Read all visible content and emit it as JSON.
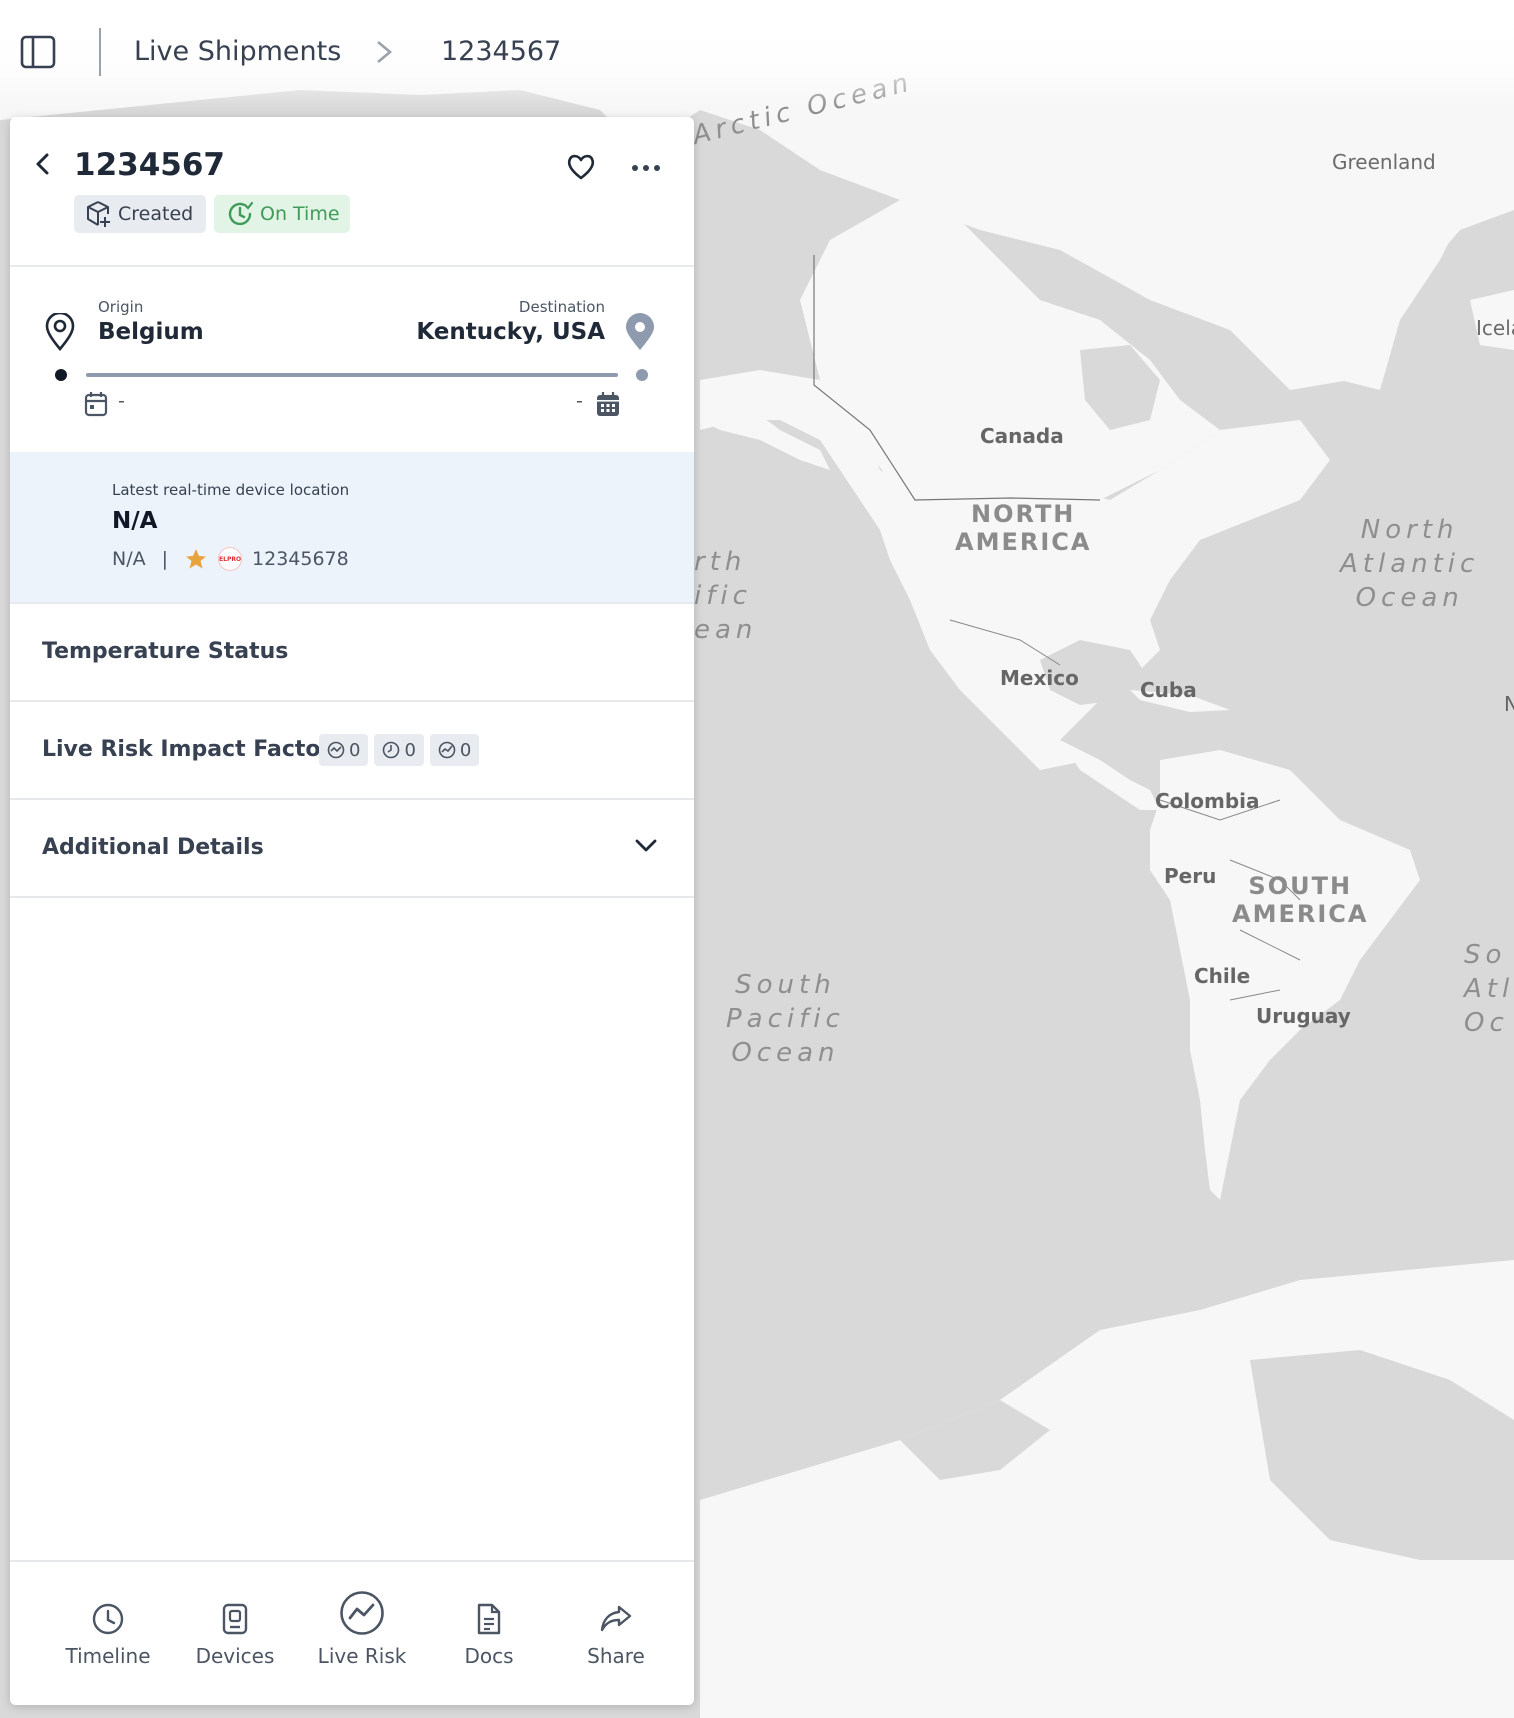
{
  "header": {
    "breadcrumb_parent": "Live Shipments",
    "breadcrumb_current": "1234567"
  },
  "shipment": {
    "id": "1234567",
    "status_badge": "Created",
    "timing_badge": "On Time",
    "origin_label": "Origin",
    "origin": "Belgium",
    "destination_label": "Destination",
    "destination": "Kentucky, USA",
    "departure_date": "-",
    "arrival_date": "-"
  },
  "device_location": {
    "label": "Latest real-time device location",
    "value": "N/A",
    "sub_value": "N/A",
    "separator": "|",
    "carrier_logo_text": "ELPRO",
    "device_id": "12345678"
  },
  "sections": {
    "temperature": "Temperature Status",
    "risk": "Live Risk Impact Factors",
    "risk_counts": [
      "0",
      "0",
      "0"
    ],
    "additional": "Additional Details"
  },
  "footer_nav": [
    {
      "label": "Timeline",
      "icon": "clock-icon"
    },
    {
      "label": "Devices",
      "icon": "device-icon"
    },
    {
      "label": "Live Risk",
      "icon": "live-risk-icon"
    },
    {
      "label": "Docs",
      "icon": "document-icon"
    },
    {
      "label": "Share",
      "icon": "share-icon"
    }
  ],
  "map_labels": {
    "arctic": "Arctic Ocean",
    "greenland": "Greenland",
    "iceland": "Icela",
    "canada": "Canada",
    "north_america": [
      "NORTH",
      "AMERICA"
    ],
    "north_atlantic": [
      "North",
      "Atlantic",
      "Ocean"
    ],
    "north_pacific": [
      "rth",
      "ific",
      "ean"
    ],
    "mexico": "Mexico",
    "cuba": "Cuba",
    "colombia": "Colombia",
    "peru": "Peru",
    "south_america": [
      "SOUTH",
      "AMERICA"
    ],
    "chile": "Chile",
    "uruguay": "Uruguay",
    "south_pacific": [
      "South",
      "Pacific",
      "Ocean"
    ],
    "south_atlantic": [
      "So",
      "Atl",
      "Oc"
    ],
    "edge_n": "N"
  },
  "colors": {
    "land": "#f7f7f7",
    "water": "#d9d9d9",
    "on_time_green": "#3e9b58",
    "highlight_blue": "#edf3fb",
    "star": "#e8a33d"
  }
}
